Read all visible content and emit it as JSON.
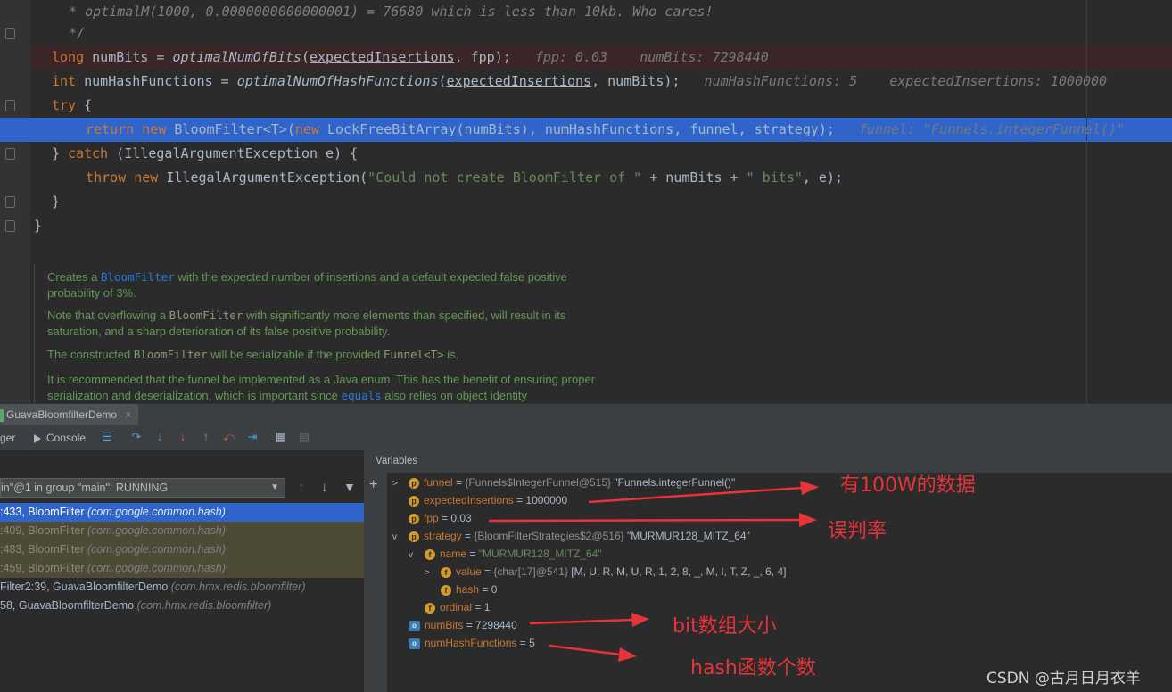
{
  "editor": {
    "lines": [
      {
        "segments": [
          {
            "t": " * optimalM(1000, 0.0000000000000001) = 76680 which is less than 10kb. Who cares!",
            "c": "cmt"
          }
        ]
      },
      {
        "segments": [
          {
            "t": " */",
            "c": "cmt"
          }
        ]
      },
      {
        "segments": [
          {
            "t": "long ",
            "c": "kw"
          },
          {
            "t": "numBits = "
          },
          {
            "t": "optimalNumOfBits",
            "c": "it"
          },
          {
            "t": "("
          },
          {
            "t": "expectedInsertions",
            "c": "ul"
          },
          {
            "t": ", fpp);   "
          },
          {
            "t": "fpp: 0.03    numBits: 7298440",
            "c": "hint"
          }
        ]
      },
      {
        "segments": [
          {
            "t": "int ",
            "c": "kw"
          },
          {
            "t": "numHashFunctions = "
          },
          {
            "t": "optimalNumOfHashFunctions",
            "c": "it"
          },
          {
            "t": "("
          },
          {
            "t": "expectedInsertions",
            "c": "ul"
          },
          {
            "t": ", numBits);   "
          },
          {
            "t": "numHashFunctions: 5    expectedInsertions: 1000000",
            "c": "hint"
          }
        ]
      },
      {
        "segments": [
          {
            "t": "try ",
            "c": "kw"
          },
          {
            "t": "{"
          }
        ]
      },
      {
        "segments": [
          {
            "t": "  return new ",
            "c": "kw"
          },
          {
            "t": "BloomFilter<T>("
          },
          {
            "t": "new ",
            "c": "kw"
          },
          {
            "t": "LockFreeBitArray(numBits), numHashFunctions, funnel, strategy);   "
          },
          {
            "t": "funnel: \"Funnels.integerFunnel()\"",
            "c": "hint"
          }
        ]
      },
      {
        "segments": [
          {
            "t": "} "
          },
          {
            "t": "catch ",
            "c": "kw"
          },
          {
            "t": "(IllegalArgumentException e) {"
          }
        ]
      },
      {
        "segments": [
          {
            "t": "  throw new ",
            "c": "kw"
          },
          {
            "t": "IllegalArgumentException("
          },
          {
            "t": "\"Could not create BloomFilter of \"",
            "c": "str"
          },
          {
            "t": " + numBits + "
          },
          {
            "t": "\" bits\"",
            "c": "str"
          },
          {
            "t": ", e);"
          }
        ]
      },
      {
        "segments": [
          {
            "t": "}"
          }
        ]
      },
      {
        "segments": [
          {
            "t": "}"
          }
        ]
      }
    ]
  },
  "doc": {
    "p1_a": "Creates a ",
    "p1_code": "BloomFilter",
    "p1_b": " with the expected number of insertions and a default expected false positive probability of 3%.",
    "p2_a": "Note that overflowing a ",
    "p2_code": "BloomFilter",
    "p2_b": " with significantly more elements than specified, will result in its saturation, and a sharp deterioration of its false positive probability.",
    "p3_a": "The constructed ",
    "p3_code": "BloomFilter",
    "p3_b": " will be serializable if the provided ",
    "p3_code2": "Funnel<T>",
    "p3_c": " is.",
    "p4_a": "It is recommended that the funnel be implemented as a Java enum. This has the benefit of ensuring proper serialization and deserialization, which is important since ",
    "p4_code": "equals",
    "p4_b": " also relies on object identity"
  },
  "debug": {
    "tab_title": "GuavaBloomfilterDemo",
    "debugger_tab": "ger",
    "console_tab": "Console",
    "variables_header": "Variables",
    "thread_select": "in\"@1 in group \"main\": RUNNING",
    "frames": [
      {
        "loc": ":433, BloomFilter ",
        "pkg": "(com.google.common.hash)",
        "state": "selected"
      },
      {
        "loc": ":409, BloomFilter ",
        "pkg": "(com.google.common.hash)",
        "state": "lib"
      },
      {
        "loc": ":483, BloomFilter ",
        "pkg": "(com.google.common.hash)",
        "state": "lib"
      },
      {
        "loc": ":459, BloomFilter ",
        "pkg": "(com.google.common.hash)",
        "state": "lib"
      },
      {
        "loc": "Filter2:39, GuavaBloomfilterDemo ",
        "pkg": "(com.hmx.redis.bloomfilter)",
        "state": "normal"
      },
      {
        "loc": "58, GuavaBloomfilterDemo ",
        "pkg": "(com.hmx.redis.bloomfilter)",
        "state": "normal"
      }
    ],
    "variables": [
      {
        "name": "funnel",
        "eq": " = ",
        "meta": "{Funnels$IntegerFunnel@515} ",
        "value": "\"Funnels.integerFunnel()\"",
        "badge": "p",
        "expander": ">"
      },
      {
        "name": "expectedInsertions",
        "eq": " = ",
        "meta": "",
        "value": "1000000",
        "badge": "p",
        "expander": ""
      },
      {
        "name": "fpp",
        "eq": " = ",
        "meta": "",
        "value": "0.03",
        "badge": "p",
        "expander": ""
      },
      {
        "name": "strategy",
        "eq": " = ",
        "meta": "{BloomFilterStrategies$2@516} ",
        "value": "\"MURMUR128_MITZ_64\"",
        "badge": "p",
        "expander": "v"
      },
      {
        "name": "name",
        "eq": " = ",
        "meta": "",
        "value": "\"MURMUR128_MITZ_64\"",
        "badge": "f",
        "expander": "v"
      },
      {
        "name": "value",
        "eq": " = ",
        "meta": "{char[17]@541} ",
        "value": "[M, U, R, M, U, R, 1, 2, 8, _, M, I, T, Z, _, 6, 4]",
        "badge": "f",
        "expander": ">"
      },
      {
        "name": "hash",
        "eq": " = ",
        "meta": "",
        "value": "0",
        "badge": "f",
        "expander": ""
      },
      {
        "name": "ordinal",
        "eq": " = ",
        "meta": "",
        "value": "1",
        "badge": "f",
        "expander": ""
      },
      {
        "name": "numBits",
        "eq": " = ",
        "meta": "",
        "value": "7298440",
        "badge": "o",
        "expander": ""
      },
      {
        "name": "numHashFunctions",
        "eq": " = ",
        "meta": "",
        "value": "5",
        "badge": "o",
        "expander": ""
      }
    ]
  },
  "annotations": {
    "a1": "有100W的数据",
    "a2": "误判率",
    "a3": "bit数组大小",
    "a4": "hash函数个数"
  },
  "watermark": "CSDN @古月日月衣羊",
  "colors": {
    "annotation": "#e8333a",
    "selection": "#2f65ca",
    "library_frame": "#4d4a35",
    "error_line": "#3b2627"
  }
}
